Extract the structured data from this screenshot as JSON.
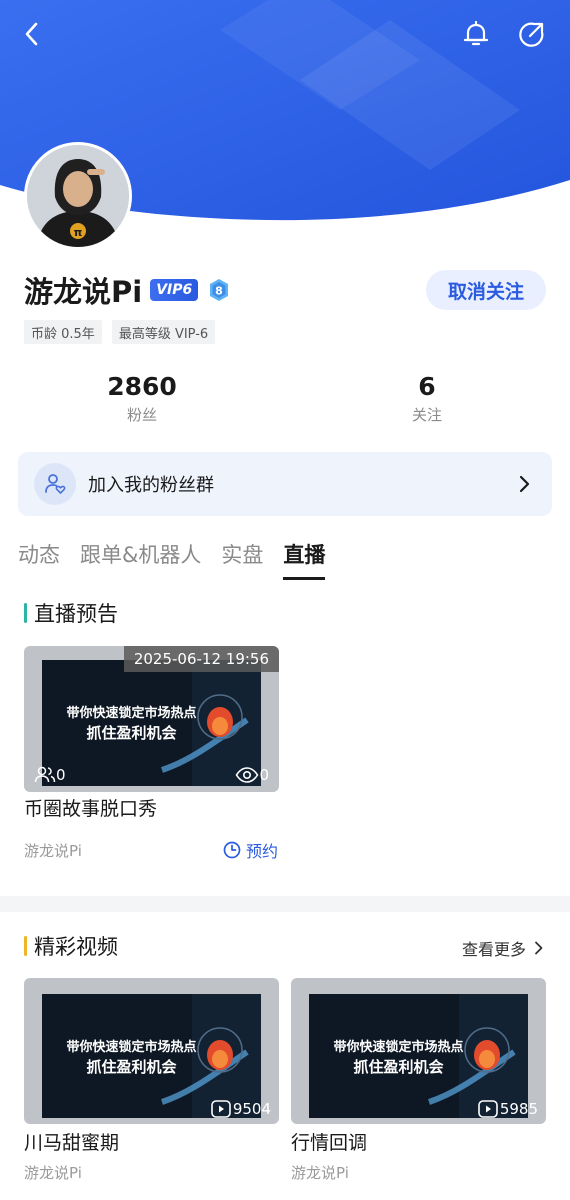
{
  "colors": {
    "brand_blue": "#2a5be0",
    "header_blue": "#2f63e8",
    "live_bar": "#2ab5a5",
    "video_bar": "#f0b429"
  },
  "topbar": {
    "back_icon": "chevron-left-icon",
    "bell_icon": "bell-icon",
    "share_icon": "share-icon"
  },
  "profile": {
    "name": "游龙说Pi",
    "vip": "VIP6",
    "level": "8",
    "unfollow_label": "取消关注",
    "tags": [
      "币龄 0.5年",
      "最高等级 VIP-6"
    ]
  },
  "stats": {
    "fans_count": "2860",
    "fans_label": "粉丝",
    "follow_count": "6",
    "follow_label": "关注"
  },
  "fan_group": {
    "label": "加入我的粉丝群"
  },
  "tabs": [
    {
      "label": "动态",
      "active": false
    },
    {
      "label": "跟单&机器人",
      "active": false
    },
    {
      "label": "实盘",
      "active": false
    },
    {
      "label": "直播",
      "active": true
    }
  ],
  "live_section": {
    "title": "直播预告",
    "card": {
      "time": "2025-06-12 19:56",
      "viewers": "0",
      "views": "0",
      "thumb_line1": "带你快速锁定市场热点",
      "thumb_line2": "抓住盈利机会",
      "title": "币圈故事脱口秀",
      "author": "游龙说Pi",
      "reserve_label": "预约"
    }
  },
  "video_section": {
    "title": "精彩视频",
    "see_more": "查看更多",
    "videos": [
      {
        "title": "川马甜蜜期",
        "author": "游龙说Pi",
        "plays": "9504",
        "thumb_line1": "带你快速锁定市场热点",
        "thumb_line2": "抓住盈利机会"
      },
      {
        "title": "行情回调",
        "author": "游龙说Pi",
        "plays": "5985",
        "thumb_line1": "带你快速锁定市场热点",
        "thumb_line2": "抓住盈利机会"
      }
    ]
  }
}
